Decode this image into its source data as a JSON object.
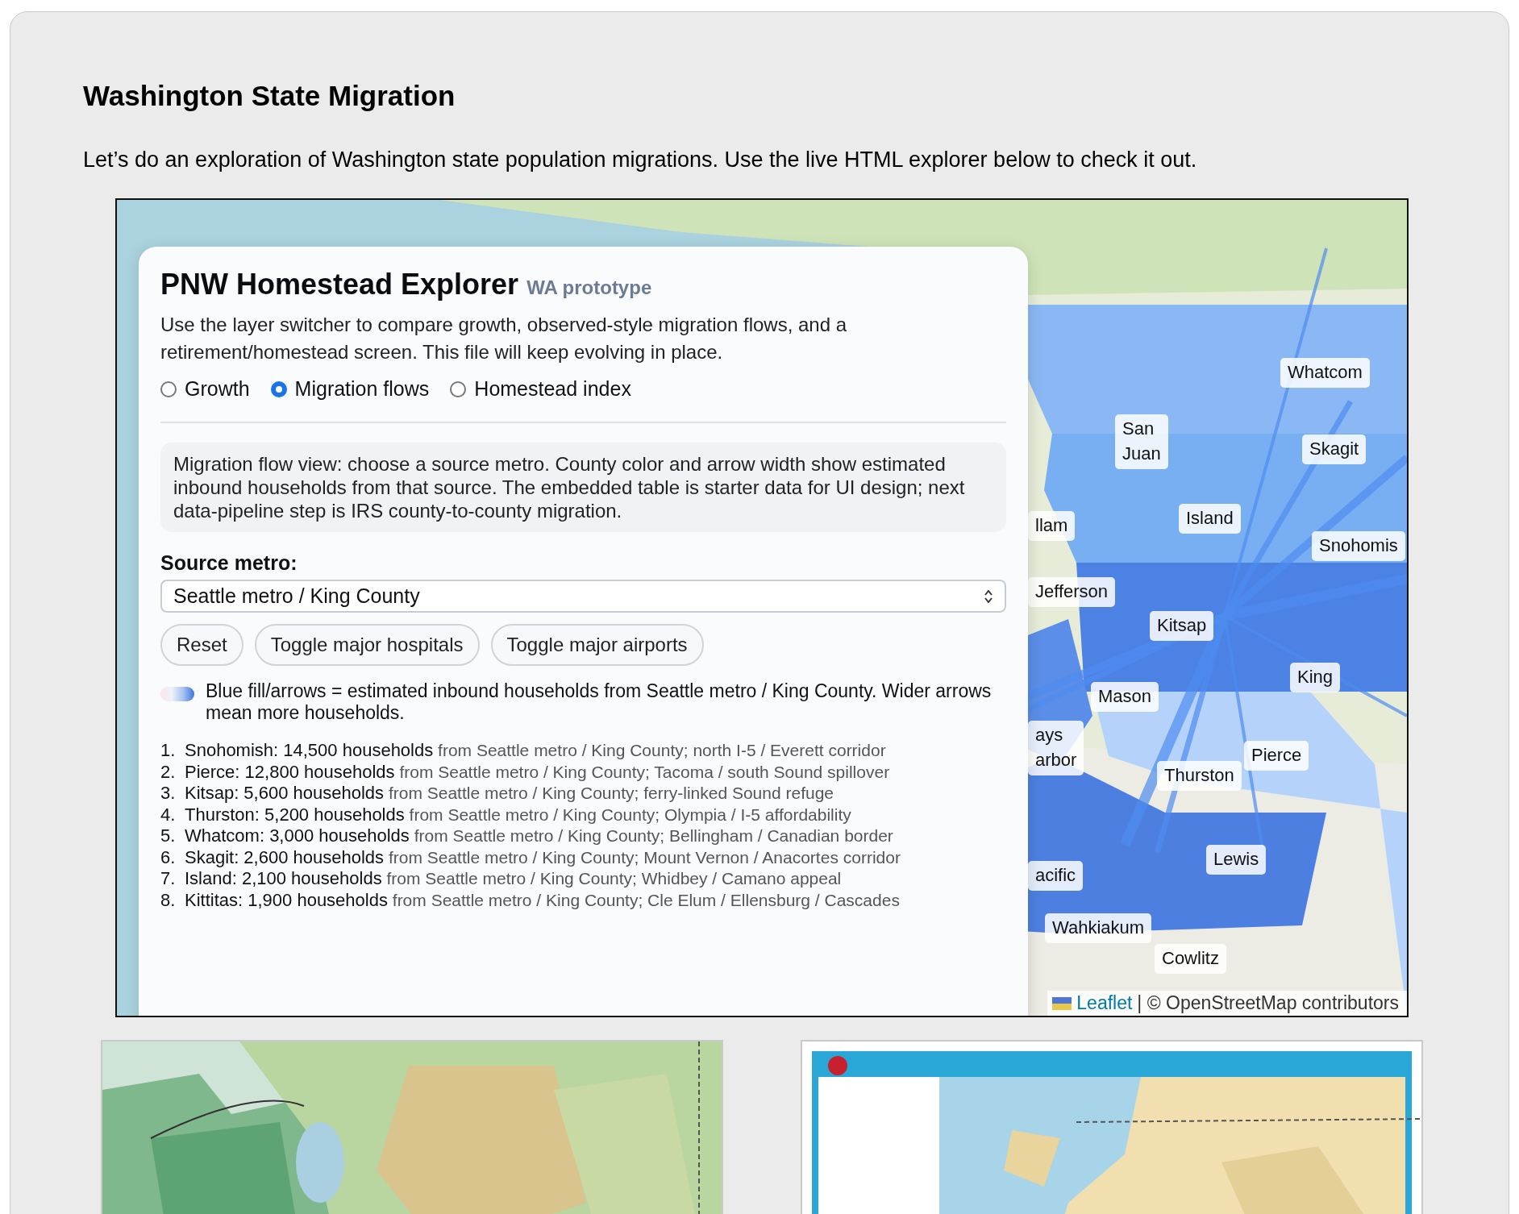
{
  "page": {
    "title": "Washington State Migration",
    "intro": "Let’s do an exploration of Washington state population migrations. Use the live HTML explorer below to check it out."
  },
  "explorer": {
    "map": {
      "county_labels": [
        {
          "lines": [
            "Whatcom"
          ]
        },
        {
          "lines": [
            "Skagit"
          ]
        },
        {
          "lines": [
            "San",
            "Juan"
          ]
        },
        {
          "lines": [
            "Island"
          ]
        },
        {
          "lines": [
            "Snohomis"
          ]
        },
        {
          "lines": [
            "llam"
          ]
        },
        {
          "lines": [
            "Jefferson"
          ]
        },
        {
          "lines": [
            "Kitsap"
          ]
        },
        {
          "lines": [
            "King"
          ]
        },
        {
          "lines": [
            "Mason"
          ]
        },
        {
          "lines": [
            "ays",
            "arbor"
          ]
        },
        {
          "lines": [
            "Pierce"
          ]
        },
        {
          "lines": [
            "Thurston"
          ]
        },
        {
          "lines": [
            "Lewis"
          ]
        },
        {
          "lines": [
            "acific"
          ]
        },
        {
          "lines": [
            "Wahkiakum"
          ]
        },
        {
          "lines": [
            "Cowlitz"
          ]
        }
      ],
      "attribution": {
        "link": "Leaflet",
        "text": "| © OpenStreetMap contributors"
      }
    },
    "panel": {
      "title": "PNW Homestead Explorer",
      "subtitle": "WA prototype",
      "description": "Use the layer switcher to compare growth, observed-style migration flows, and a retirement/homestead screen. This file will keep evolving in place.",
      "layers": [
        {
          "label": "Growth",
          "selected": false
        },
        {
          "label": "Migration flows",
          "selected": true
        },
        {
          "label": "Homestead index",
          "selected": false
        }
      ],
      "note": "Migration flow view: choose a source metro. County color and arrow width show estimated inbound households from that source. The embedded table is starter data for UI design; next data-pipeline step is IRS county-to-county migration.",
      "source_label": "Source metro:",
      "source_value": "Seattle metro / King County",
      "buttons": [
        "Reset",
        "Toggle major hospitals",
        "Toggle major airports"
      ],
      "legend": "Blue fill/arrows = estimated inbound households from Seattle metro / King County. Wider arrows mean more households.",
      "flows": [
        {
          "number": "1.",
          "county": "Snohomish: 14,500 households",
          "detail": "from Seattle metro / King County; north I-5 / Everett corridor"
        },
        {
          "number": "2.",
          "county": "Pierce: 12,800 households",
          "detail": "from Seattle metro / King County; Tacoma / south Sound spillover"
        },
        {
          "number": "3.",
          "county": "Kitsap: 5,600 households",
          "detail": "from Seattle metro / King County; ferry-linked Sound refuge"
        },
        {
          "number": "4.",
          "county": "Thurston: 5,200 households",
          "detail": "from Seattle metro / King County; Olympia / I-5 affordability"
        },
        {
          "number": "5.",
          "county": "Whatcom: 3,000 households",
          "detail": "from Seattle metro / King County; Bellingham / Canadian border"
        },
        {
          "number": "6.",
          "county": "Skagit: 2,600 households",
          "detail": "from Seattle metro / King County; Mount Vernon / Anacortes corridor"
        },
        {
          "number": "7.",
          "county": "Island: 2,100 households",
          "detail": "from Seattle metro / King County; Whidbey / Camano appeal"
        },
        {
          "number": "8.",
          "county": "Kittitas: 1,900 households",
          "detail": "from Seattle metro / King County; Cle Elum / Ellensburg / Cascades"
        }
      ]
    }
  }
}
